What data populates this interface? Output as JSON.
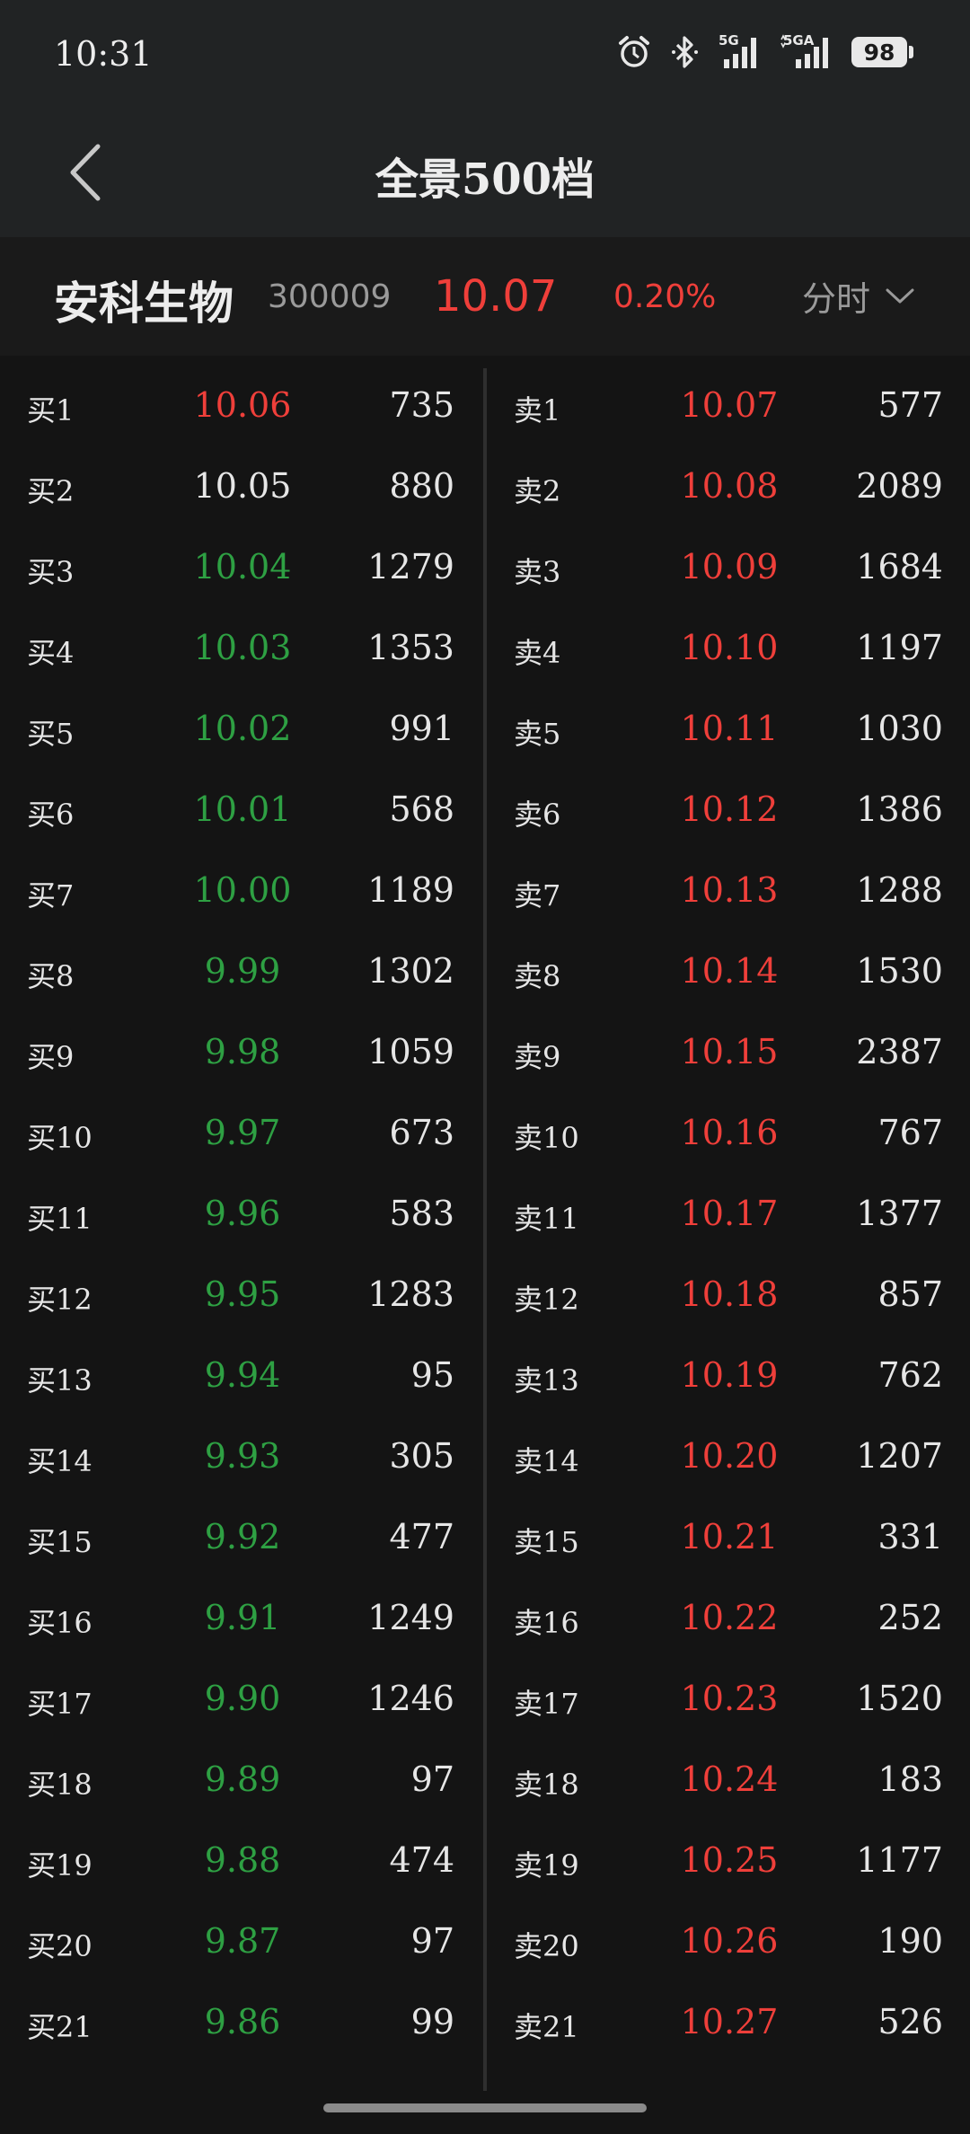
{
  "status_bar": {
    "time": "10:31",
    "network_1": "5G",
    "network_2": "5GA",
    "battery": "98"
  },
  "nav": {
    "title": "全景500档"
  },
  "stock": {
    "name": "安科生物",
    "code": "300009",
    "price": "10.07",
    "change_pct": "0.20%",
    "period": "分时"
  },
  "colors": {
    "up": "#ef3f3a",
    "down": "#2ea043",
    "neutral": "#e6e6e6",
    "background": "#141414"
  },
  "bids": [
    {
      "label": "买1",
      "price": "10.06",
      "volume": "735",
      "dir": "up"
    },
    {
      "label": "买2",
      "price": "10.05",
      "volume": "880",
      "dir": "flat"
    },
    {
      "label": "买3",
      "price": "10.04",
      "volume": "1279",
      "dir": "down"
    },
    {
      "label": "买4",
      "price": "10.03",
      "volume": "1353",
      "dir": "down"
    },
    {
      "label": "买5",
      "price": "10.02",
      "volume": "991",
      "dir": "down"
    },
    {
      "label": "买6",
      "price": "10.01",
      "volume": "568",
      "dir": "down"
    },
    {
      "label": "买7",
      "price": "10.00",
      "volume": "1189",
      "dir": "down"
    },
    {
      "label": "买8",
      "price": "9.99",
      "volume": "1302",
      "dir": "down"
    },
    {
      "label": "买9",
      "price": "9.98",
      "volume": "1059",
      "dir": "down"
    },
    {
      "label": "买10",
      "price": "9.97",
      "volume": "673",
      "dir": "down"
    },
    {
      "label": "买11",
      "price": "9.96",
      "volume": "583",
      "dir": "down"
    },
    {
      "label": "买12",
      "price": "9.95",
      "volume": "1283",
      "dir": "down"
    },
    {
      "label": "买13",
      "price": "9.94",
      "volume": "95",
      "dir": "down"
    },
    {
      "label": "买14",
      "price": "9.93",
      "volume": "305",
      "dir": "down"
    },
    {
      "label": "买15",
      "price": "9.92",
      "volume": "477",
      "dir": "down"
    },
    {
      "label": "买16",
      "price": "9.91",
      "volume": "1249",
      "dir": "down"
    },
    {
      "label": "买17",
      "price": "9.90",
      "volume": "1246",
      "dir": "down"
    },
    {
      "label": "买18",
      "price": "9.89",
      "volume": "97",
      "dir": "down"
    },
    {
      "label": "买19",
      "price": "9.88",
      "volume": "474",
      "dir": "down"
    },
    {
      "label": "买20",
      "price": "9.87",
      "volume": "97",
      "dir": "down"
    },
    {
      "label": "买21",
      "price": "9.86",
      "volume": "99",
      "dir": "down"
    }
  ],
  "asks": [
    {
      "label": "卖1",
      "price": "10.07",
      "volume": "577",
      "dir": "up"
    },
    {
      "label": "卖2",
      "price": "10.08",
      "volume": "2089",
      "dir": "up"
    },
    {
      "label": "卖3",
      "price": "10.09",
      "volume": "1684",
      "dir": "up"
    },
    {
      "label": "卖4",
      "price": "10.10",
      "volume": "1197",
      "dir": "up"
    },
    {
      "label": "卖5",
      "price": "10.11",
      "volume": "1030",
      "dir": "up"
    },
    {
      "label": "卖6",
      "price": "10.12",
      "volume": "1386",
      "dir": "up"
    },
    {
      "label": "卖7",
      "price": "10.13",
      "volume": "1288",
      "dir": "up"
    },
    {
      "label": "卖8",
      "price": "10.14",
      "volume": "1530",
      "dir": "up"
    },
    {
      "label": "卖9",
      "price": "10.15",
      "volume": "2387",
      "dir": "up"
    },
    {
      "label": "卖10",
      "price": "10.16",
      "volume": "767",
      "dir": "up"
    },
    {
      "label": "卖11",
      "price": "10.17",
      "volume": "1377",
      "dir": "up"
    },
    {
      "label": "卖12",
      "price": "10.18",
      "volume": "857",
      "dir": "up"
    },
    {
      "label": "卖13",
      "price": "10.19",
      "volume": "762",
      "dir": "up"
    },
    {
      "label": "卖14",
      "price": "10.20",
      "volume": "1207",
      "dir": "up"
    },
    {
      "label": "卖15",
      "price": "10.21",
      "volume": "331",
      "dir": "up"
    },
    {
      "label": "卖16",
      "price": "10.22",
      "volume": "252",
      "dir": "up"
    },
    {
      "label": "卖17",
      "price": "10.23",
      "volume": "1520",
      "dir": "up"
    },
    {
      "label": "卖18",
      "price": "10.24",
      "volume": "183",
      "dir": "up"
    },
    {
      "label": "卖19",
      "price": "10.25",
      "volume": "1177",
      "dir": "up"
    },
    {
      "label": "卖20",
      "price": "10.26",
      "volume": "190",
      "dir": "up"
    },
    {
      "label": "卖21",
      "price": "10.27",
      "volume": "526",
      "dir": "up"
    }
  ]
}
